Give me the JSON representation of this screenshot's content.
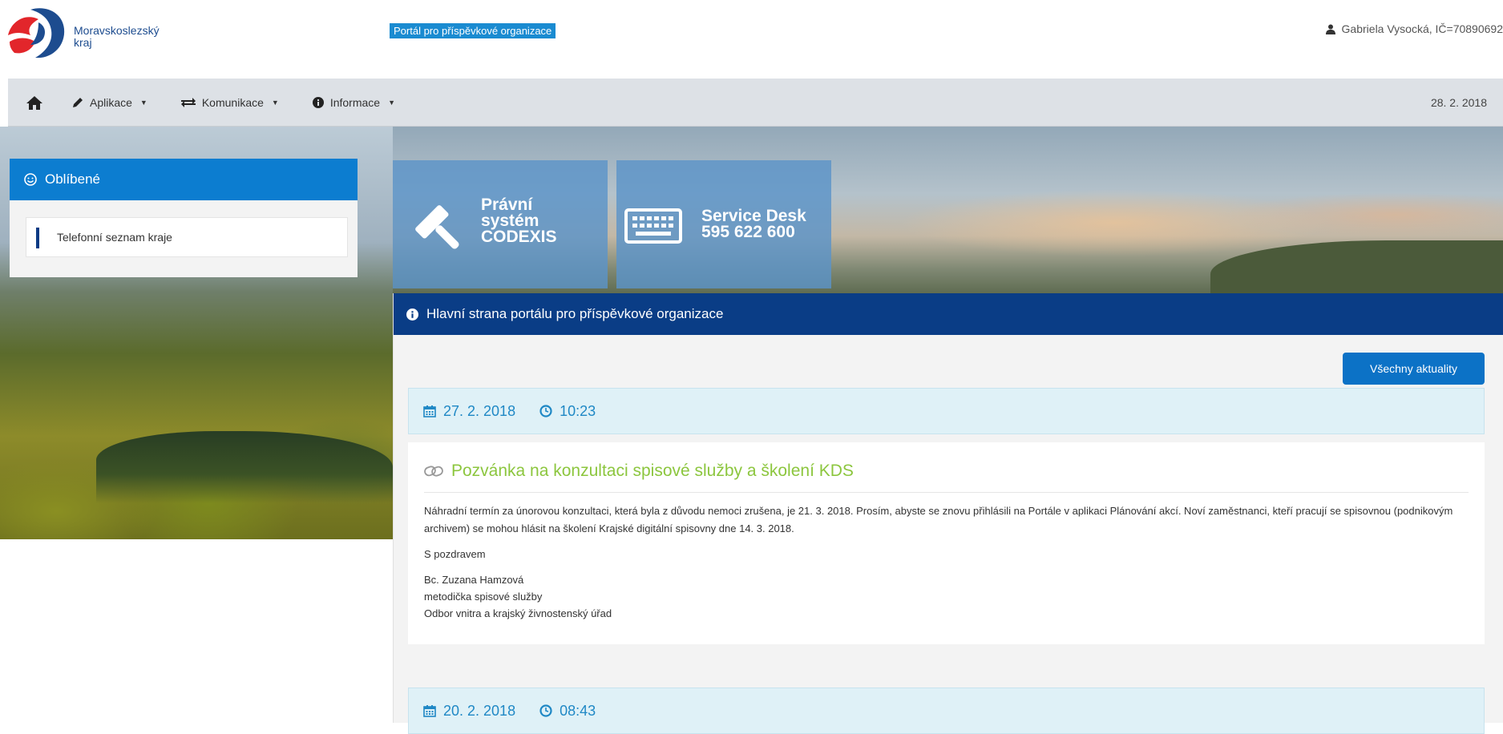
{
  "header": {
    "logo_line1": "Moravskoslezský",
    "logo_line2": "kraj",
    "portal_label": "Portál pro příspěvkové organizace",
    "user": "Gabriela Vysocká, IČ=70890692"
  },
  "nav": {
    "items": [
      {
        "label": "Aplikace",
        "icon": "pencil-icon"
      },
      {
        "label": "Komunikace",
        "icon": "exchange-icon"
      },
      {
        "label": "Informace",
        "icon": "info-icon"
      }
    ],
    "date": "28. 2. 2018"
  },
  "sidebar": {
    "title": "Oblíbené",
    "items": [
      {
        "label": "Telefonní seznam kraje"
      }
    ]
  },
  "tiles": [
    {
      "line1": "Právní",
      "line2": "systém",
      "line3": "CODEXIS",
      "icon": "gavel-icon"
    },
    {
      "line1": "Service Desk",
      "line2": "595 622 600",
      "icon": "keyboard-icon"
    }
  ],
  "main": {
    "heading": "Hlavní strana portálu pro příspěvkové organizace",
    "all_news_button": "Všechny aktuality",
    "news": [
      {
        "date": "27. 2. 2018",
        "time": "10:23",
        "title": "Pozvánka na konzultaci spisové služby a školení KDS",
        "paragraph": "Náhradní termín za únorovou konzultaci, která byla z důvodu nemoci zrušena, je 21. 3. 2018. Prosím, abyste se znovu přihlásili na Portále v aplikaci Plánování akcí. Noví zaměstnanci, kteří pracují se spisovnou (podnikovým archivem) se mohou hlásit na školení Krajské digitální spisovny dne 14. 3. 2018.",
        "greeting": "S pozdravem",
        "signature_name": "Bc. Zuzana Hamzová",
        "signature_role": "metodička spisové služby",
        "signature_dept": "Odbor vnitra a krajský živnostenský úřad"
      },
      {
        "date": "20. 2. 2018",
        "time": "08:43"
      }
    ]
  },
  "colors": {
    "brand_blue": "#0a3d86",
    "accent_blue": "#0c7dd0",
    "title_green": "#8cc63e",
    "news_bar_bg": "#dff1f7"
  }
}
